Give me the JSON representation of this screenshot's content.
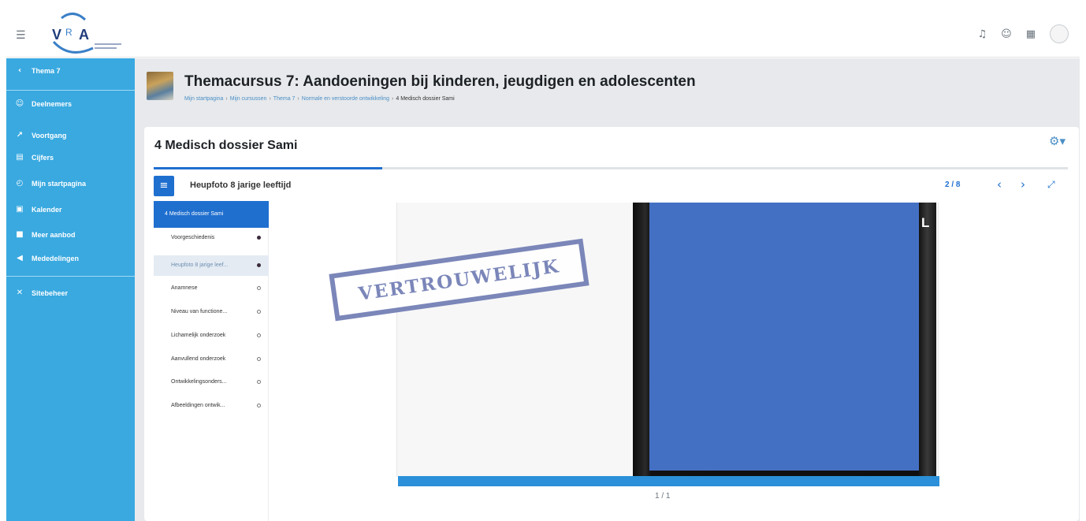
{
  "header": {
    "logo_text": "VRA",
    "icons": [
      "bell-icon",
      "chat-icon",
      "grid-icon"
    ]
  },
  "sidebar": {
    "items": [
      {
        "label": "Thema 7",
        "icon": "chevron-left-icon"
      },
      {
        "label": "Deelnemers",
        "icon": "users-icon"
      },
      {
        "label": "Voortgang",
        "icon": "chart-icon"
      },
      {
        "label": "Cijfers",
        "icon": "table-icon"
      },
      {
        "label": "Mijn startpagina",
        "icon": "speedometer-icon"
      },
      {
        "label": "Kalender",
        "icon": "calendar-icon"
      },
      {
        "label": "Meer aanbod",
        "icon": "book-icon"
      },
      {
        "label": "Mededelingen",
        "icon": "megaphone-icon"
      },
      {
        "label": "Sitebeheer",
        "icon": "wrench-icon"
      }
    ]
  },
  "course": {
    "title": "Themacursus 7: Aandoeningen bij kinderen, jeugdigen en adolescenten",
    "breadcrumb": [
      "Mijn startpagina",
      "Mijn cursussen",
      "Thema 7",
      "Normale en verstoorde ontwikkeling",
      "4 Medisch dossier Sami"
    ],
    "breadcrumb_sep": "›"
  },
  "page": {
    "title": "4 Medisch dossier Sami"
  },
  "viewer": {
    "progress_percent": 25,
    "menu_icon": "menu-icon",
    "slide_title": "Heupfoto 8 jarige leeftijd",
    "counter": "2 / 8",
    "prev": "‹",
    "next": "›",
    "fullscreen": "⤢",
    "toc_title": "4 Medisch dossier Sami",
    "toc_items": [
      {
        "label": "Voorgeschiedenis",
        "state": "filled",
        "active": false
      },
      {
        "label": "Heupfoto 8 jarige leef...",
        "state": "filled",
        "active": true
      },
      {
        "label": "Anamnese",
        "state": "empty",
        "active": false
      },
      {
        "label": "Niveau van functione...",
        "state": "empty",
        "active": false
      },
      {
        "label": "Lichamelijk onderzoek",
        "state": "empty",
        "active": false
      },
      {
        "label": "Aanvullend onderzoek",
        "state": "empty",
        "active": false
      },
      {
        "label": "Ontwikkelingsonders...",
        "state": "empty",
        "active": false
      },
      {
        "label": "Afbeeldingen ontwik...",
        "state": "empty",
        "active": false
      }
    ],
    "stamp": "VERTROUWELIJK",
    "xray_marker": "L",
    "page_count": "1 / 1"
  },
  "colors": {
    "sidebar": "#39a9e0",
    "accent": "#1f6fcf",
    "stamp": "#7b86b9",
    "xray_overlay": "#4470c4"
  }
}
